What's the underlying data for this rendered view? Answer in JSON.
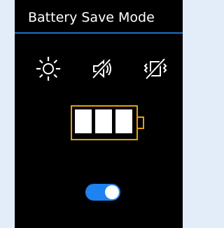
{
  "header": {
    "title": "Battery Save Mode"
  },
  "icons": [
    {
      "name": "brightness-icon"
    },
    {
      "name": "sound-off-icon"
    },
    {
      "name": "vibration-off-icon"
    }
  ],
  "battery": {
    "level": "3/3 bars",
    "colors": {
      "outline": "#e0a20a",
      "cells": "#ffffff"
    }
  },
  "toggle": {
    "state": "on",
    "color": "#1e82f0"
  },
  "colors": {
    "background": "#000000",
    "accent_line": "#1f6fd1",
    "page_margin": "#e3edf9"
  }
}
